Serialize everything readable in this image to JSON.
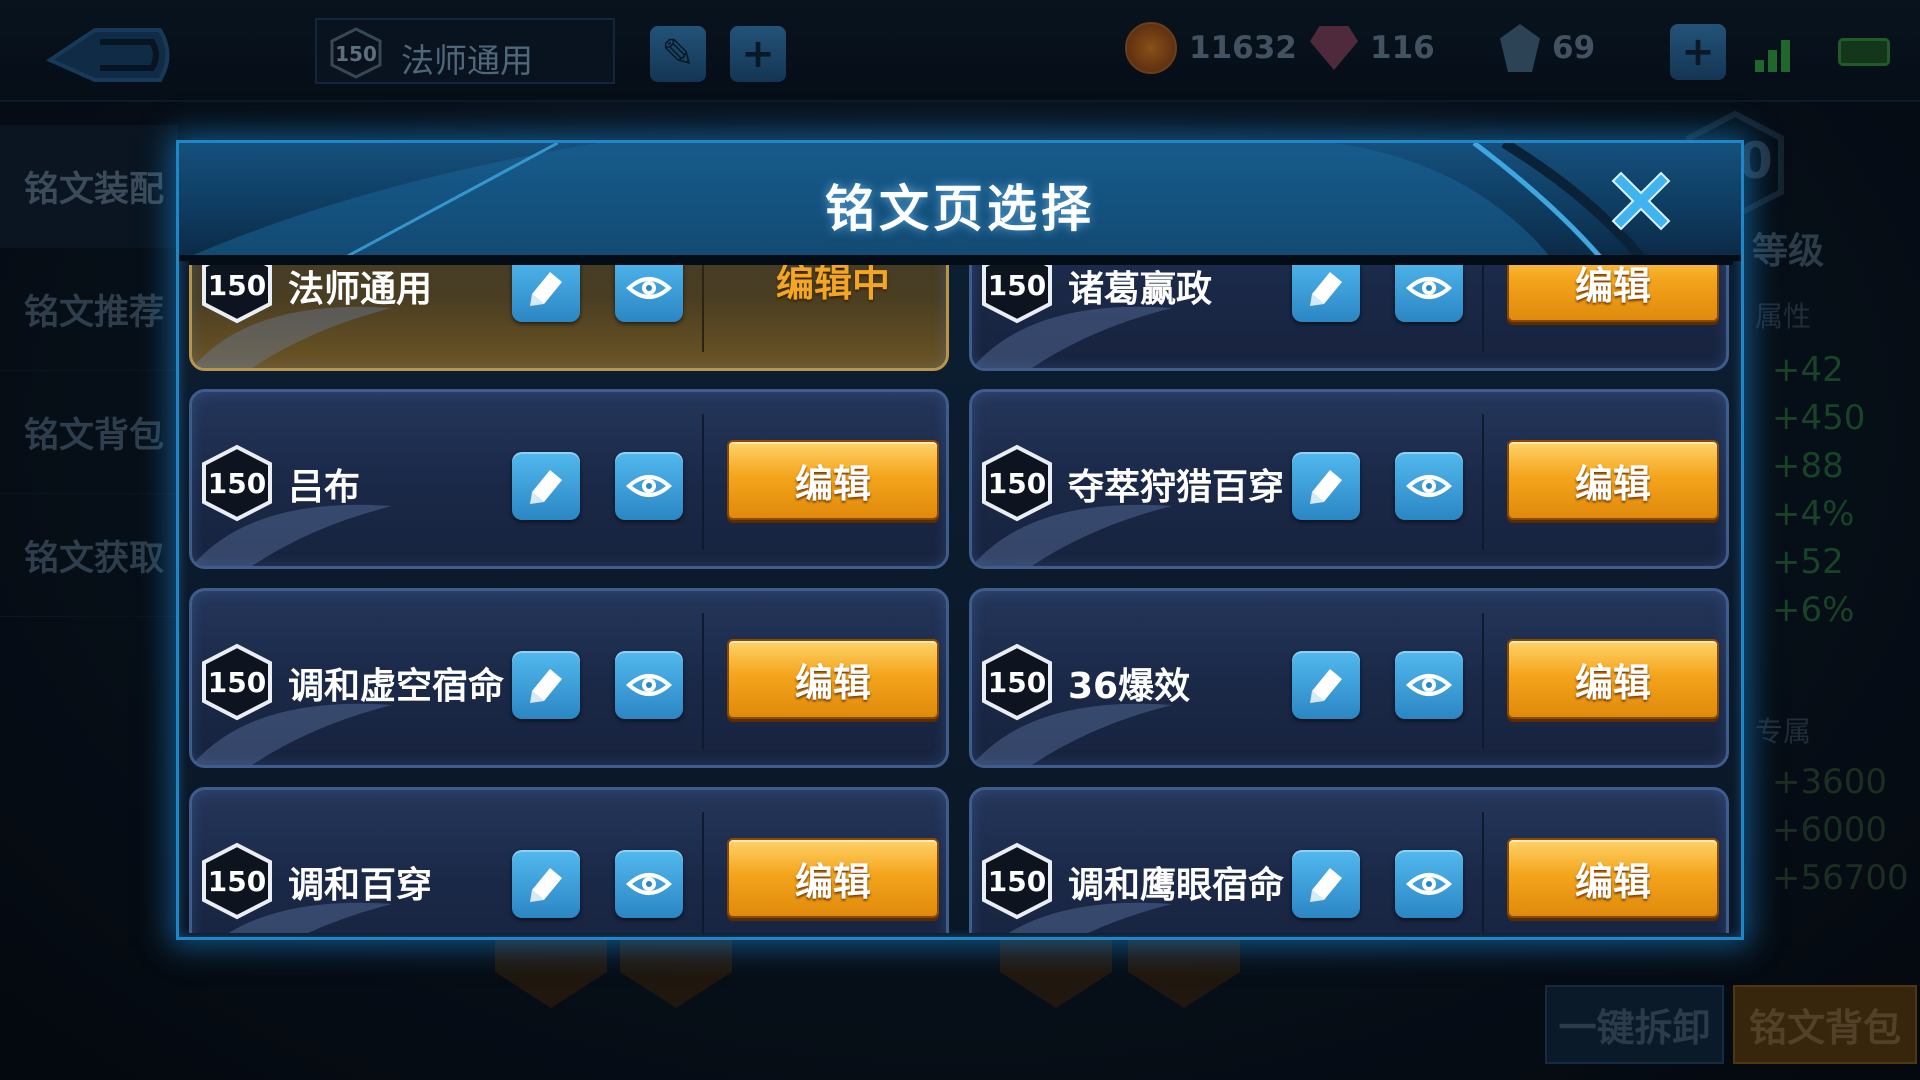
{
  "topbar": {
    "current_page": {
      "level": "150",
      "name": "法师通用"
    },
    "resources": [
      {
        "name": "gold",
        "value": "11632",
        "icon": "coin-icon"
      },
      {
        "name": "diamond",
        "value": "116",
        "icon": "gem-icon"
      },
      {
        "name": "crystal",
        "value": "69",
        "icon": "crystal-icon"
      }
    ]
  },
  "sidebar": {
    "items": [
      {
        "label": "铭文装配",
        "active": true
      },
      {
        "label": "铭文推荐"
      },
      {
        "label": "铭文背包"
      },
      {
        "label": "铭文获取"
      }
    ]
  },
  "right_panel": {
    "level_label": "等级",
    "level_value": "0",
    "attr_header": "属性",
    "stats": [
      "+42",
      "+450",
      "+88",
      "+4%",
      "+52",
      "+6%"
    ],
    "exclusive_header": "专属",
    "exclusive_stats": [
      "+3600",
      "+6000",
      "+56700"
    ]
  },
  "bottom_buttons": {
    "unequip_all": "一键拆卸",
    "backpack": "铭文背包"
  },
  "modal": {
    "title": "铭文页选择",
    "editing_label": "编辑中",
    "edit_label": "编辑",
    "pages": [
      {
        "level": "150",
        "name": "法师通用",
        "editing": true
      },
      {
        "level": "150",
        "name": "诸葛赢政",
        "editing": false
      },
      {
        "level": "150",
        "name": "吕布",
        "editing": false
      },
      {
        "level": "150",
        "name": "夺萃狩猎百穿",
        "editing": false
      },
      {
        "level": "150",
        "name": "调和虚空宿命",
        "editing": false
      },
      {
        "level": "150",
        "name": "36爆效",
        "editing": false
      },
      {
        "level": "150",
        "name": "调和百穿",
        "editing": false
      },
      {
        "level": "150",
        "name": "调和鹰眼宿命",
        "editing": false
      }
    ]
  },
  "colors": {
    "accent_blue": "#1f86c8",
    "edit_orange": "#f4a51c",
    "active_gold": "#b89548"
  }
}
